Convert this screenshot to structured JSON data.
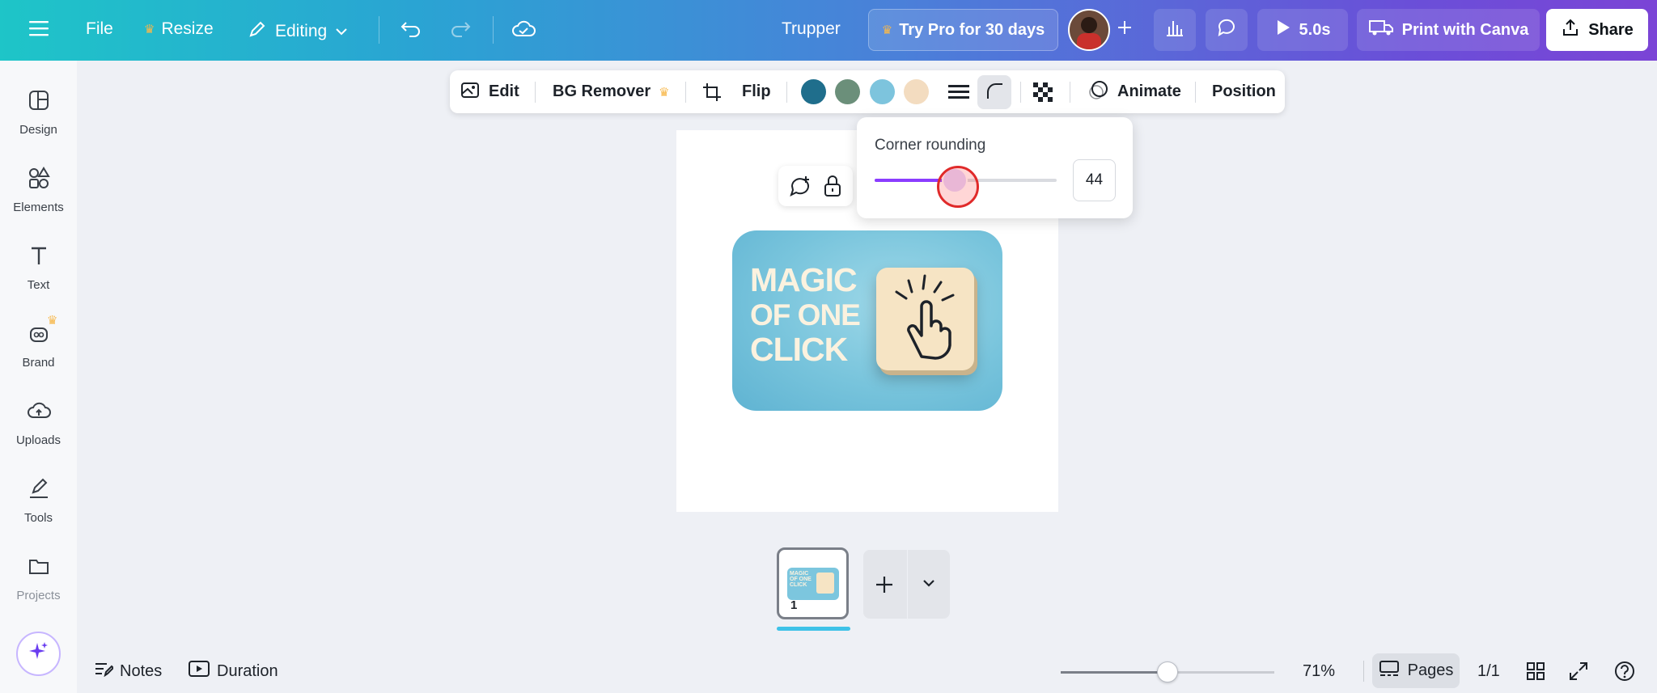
{
  "topbar": {
    "file_label": "File",
    "resize_label": "Resize",
    "editing_label": "Editing",
    "design_title": "Trupper",
    "try_pro_label": "Try Pro for 30 days",
    "play_duration": "5.0s",
    "print_label": "Print with Canva",
    "share_label": "Share"
  },
  "sidebar": {
    "items": [
      {
        "label": "Design"
      },
      {
        "label": "Elements"
      },
      {
        "label": "Text"
      },
      {
        "label": "Brand"
      },
      {
        "label": "Uploads"
      },
      {
        "label": "Tools"
      },
      {
        "label": "Projects"
      }
    ]
  },
  "context_toolbar": {
    "edit_label": "Edit",
    "bg_remover_label": "BG Remover",
    "flip_label": "Flip",
    "animate_label": "Animate",
    "position_label": "Position",
    "swatches": [
      "#1f6e8c",
      "#6b8f7a",
      "#7dc4dd",
      "#f3dcc0"
    ]
  },
  "corner_popover": {
    "title": "Corner rounding",
    "value": "44",
    "slider_fraction": 0.44
  },
  "canvas": {
    "card_text_line1": "MAGIC",
    "card_text_line2": "OF ONE",
    "card_text_line3": "CLICK"
  },
  "pages": {
    "thumb_number": "1",
    "thumb_text": "MAGIC OF ONE CLICK"
  },
  "bottombar": {
    "notes_label": "Notes",
    "duration_label": "Duration",
    "zoom": "71%",
    "zoom_fraction": 0.5,
    "pages_label": "Pages",
    "page_count": "1/1"
  }
}
